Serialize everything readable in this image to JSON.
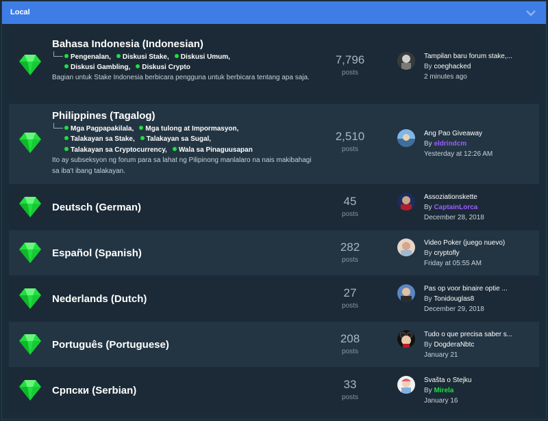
{
  "header": {
    "title": "Local"
  },
  "forums": [
    {
      "title": "Bahasa Indonesia (Indonesian)",
      "subforum_lines": [
        [
          "Pengenalan,",
          "Diskusi Stake,",
          "Diskusi Umum,"
        ],
        [
          "Diskusi Gambling,",
          "Diskusi Crypto"
        ]
      ],
      "description": "Bagian untuk Stake Indonesia berbicara pengguna untuk berbicara tentang apa saja.",
      "posts": "7,796",
      "posts_label": "posts",
      "last_title": "Tampilan baru forum stake,...",
      "by": "By",
      "last_user": "coeghacked",
      "last_time": "2 minutes ago"
    },
    {
      "title": "Philippines (Tagalog)",
      "subforum_lines": [
        [
          "Mga Pagpapakilala,",
          "Mga tulong at Impormasyon,"
        ],
        [
          "Talakayan sa Stake,",
          "Talakayan sa Sugal,"
        ],
        [
          "Talakayan sa Cryptocurrency,",
          "Wala sa Pinaguusapan"
        ]
      ],
      "description": "Ito ay subseksyon ng forum para sa lahat ng Pilipinong manlalaro na nais makibahagi sa iba't ibang talakayan.",
      "posts": "2,510",
      "posts_label": "posts",
      "last_title": "Ang Pao Giveaway",
      "by": "By",
      "last_user": "eldrindcm",
      "last_time": "Yesterday at 12:26 AM"
    },
    {
      "title": "Deutsch (German)",
      "posts": "45",
      "posts_label": "posts",
      "last_title": "Assoziationskette",
      "by": "By",
      "last_user": "CaptainLorca",
      "last_time": "December 28, 2018"
    },
    {
      "title": "Español (Spanish)",
      "posts": "282",
      "posts_label": "posts",
      "last_title": "Video Poker (juego nuevo)",
      "by": "By",
      "last_user": "cryptofly",
      "last_time": "Friday at 05:55 AM"
    },
    {
      "title": "Nederlands (Dutch)",
      "posts": "27",
      "posts_label": "posts",
      "last_title": "Pas op voor binaire optie ...",
      "by": "By",
      "last_user": "Tonidouglas8",
      "last_time": "December 29, 2018"
    },
    {
      "title": "Português (Portuguese)",
      "posts": "208",
      "posts_label": "posts",
      "last_title": "Tudo o que precisa saber s...",
      "by": "By",
      "last_user": "DogderaNbtc",
      "last_time": "January 21"
    },
    {
      "title": "Српски (Serbian)",
      "posts": "33",
      "posts_label": "posts",
      "last_title": "Svašta o Stejku",
      "by": "By",
      "last_user": "Mirela",
      "last_time": "January 16"
    }
  ],
  "icons": {
    "forum": "gem-icon",
    "collapse": "chevron-down-icon"
  },
  "colors": {
    "header": "#3f7de6",
    "gem": "#1fdf3f",
    "purple_user": "#9a5cff",
    "green_user": "#1fdf3f"
  }
}
